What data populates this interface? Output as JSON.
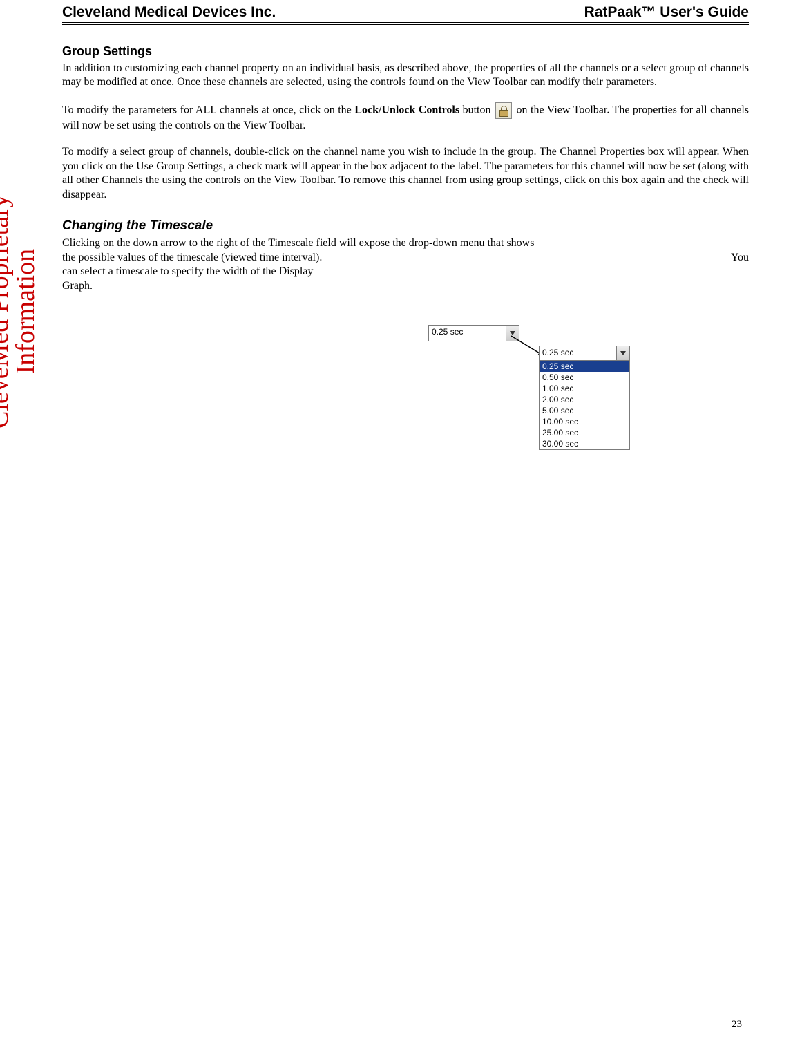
{
  "header": {
    "left": "Cleveland Medical Devices Inc.",
    "right": "RatPaak™ User's Guide"
  },
  "watermark": {
    "line1": "CleveMed Proprietary",
    "line2": "Information"
  },
  "sections": {
    "group_settings": {
      "heading": "Group Settings",
      "p1": "In addition to customizing each channel property on an individual basis, as described above, the properties of all the channels or a select group of channels may be modified at once.  Once these channels are selected, using the controls found on the View Toolbar can modify their parameters.",
      "p2_pre": "To modify the parameters for ALL channels at once, click on the ",
      "p2_bold": "Lock/Unlock Controls",
      "p2_mid": " button ",
      "p2_post": " on the View Toolbar.  The properties for all channels will now be set using the controls on the View Toolbar.",
      "p3": "To modify a select group of channels, double-click on the channel name you wish to include in the group.  The Channel Properties box will appear.  When you click on the Use Group Settings, a check mark will appear in the box adjacent to the label.  The parameters for this channel will now be set (along with all other Channels the using the controls on the View Toolbar.  To remove this channel from using group settings, click on this box again and the check will disappear."
    },
    "timescale": {
      "heading": "Changing the Timescale",
      "p1_line1": "Clicking on the down arrow to the right of the Timescale field will expose the drop-down menu that shows",
      "p1_line2_left": "the possible values of the timescale (viewed time interval).",
      "p1_line2_right": "You",
      "p1_line3": "can select a timescale to specify the width of the Display",
      "p1_line4": "Graph."
    }
  },
  "combo": {
    "selected": "0.25 sec",
    "options": [
      "0.25 sec",
      "0.50 sec",
      "1.00 sec",
      "2.00 sec",
      "5.00 sec",
      "10.00 sec",
      "25.00 sec",
      "30.00 sec"
    ]
  },
  "page_number": "23"
}
